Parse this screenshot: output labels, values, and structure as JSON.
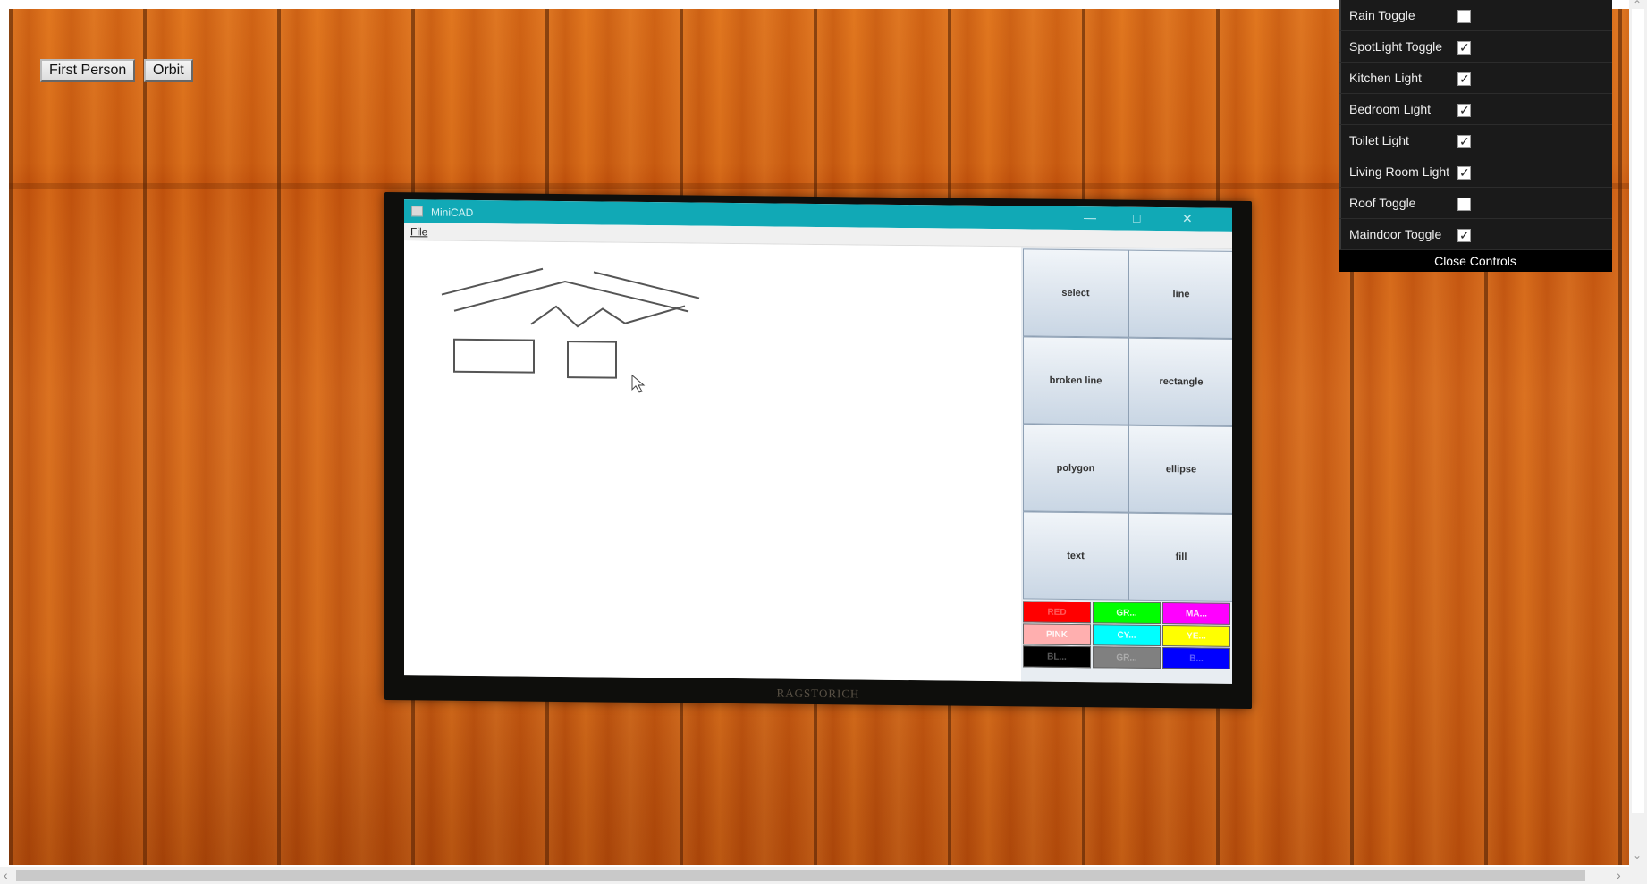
{
  "camera_buttons": {
    "first_person": "First Person",
    "orbit": "Orbit"
  },
  "minicad": {
    "window_title": "MiniCAD",
    "menu_file": "File",
    "tools": [
      {
        "label": "select"
      },
      {
        "label": "line"
      },
      {
        "label": "broken line"
      },
      {
        "label": "rectangle"
      },
      {
        "label": "polygon"
      },
      {
        "label": "ellipse"
      },
      {
        "label": "text"
      },
      {
        "label": "fill"
      }
    ],
    "colors": [
      {
        "label": "RED",
        "color": "#ff0000"
      },
      {
        "label": "GR...",
        "color": "#00ff00"
      },
      {
        "label": "MA...",
        "color": "#ff00ff"
      },
      {
        "label": "PINK",
        "color": "#ffafaf"
      },
      {
        "label": "CY...",
        "color": "#00ffff"
      },
      {
        "label": "YE...",
        "color": "#ffff00"
      },
      {
        "label": "BL...",
        "color": "#000000"
      },
      {
        "label": "GR...",
        "color": "#808080"
      },
      {
        "label": "B...",
        "color": "#0000ff"
      }
    ],
    "brand": "RAGSTORICH"
  },
  "controls": {
    "items": [
      {
        "label": "Rain Toggle",
        "checked": false
      },
      {
        "label": "SpotLight Toggle",
        "checked": true
      },
      {
        "label": "Kitchen Light",
        "checked": true
      },
      {
        "label": "Bedroom Light",
        "checked": true
      },
      {
        "label": "Toilet Light",
        "checked": true
      },
      {
        "label": "Living Room Light",
        "checked": true
      },
      {
        "label": "Roof Toggle",
        "checked": false
      },
      {
        "label": "Maindoor Toggle",
        "checked": true
      }
    ],
    "close_label": "Close Controls"
  },
  "colors": {
    "titlebar": "#11a9b6",
    "wood": "#d2641a",
    "panel": "#1a1a1a"
  }
}
